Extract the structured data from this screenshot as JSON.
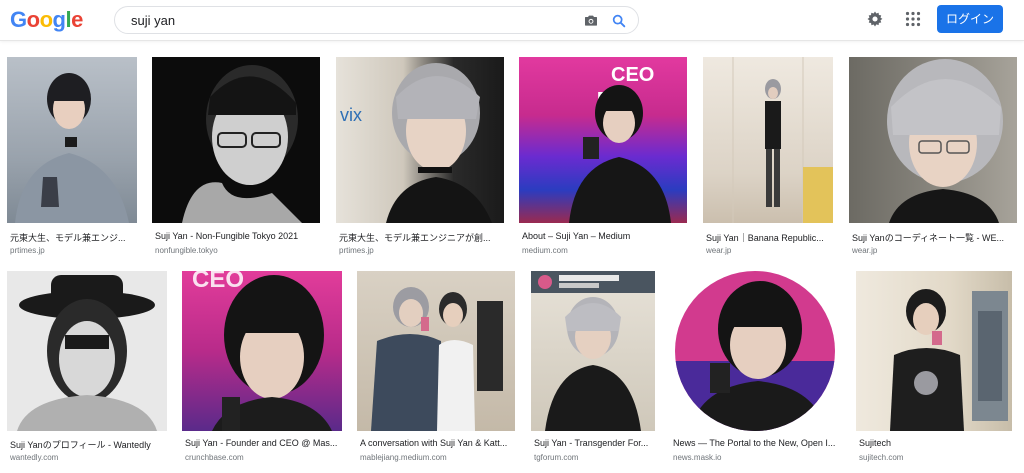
{
  "header": {
    "logo_text": "Google",
    "search_value": "suji yan",
    "login_label": "ログイン",
    "accent_color": "#1a73e8"
  },
  "icons": {
    "camera": "camera-icon",
    "search": "search-icon",
    "settings": "gear-icon",
    "apps": "apps-grid-icon"
  },
  "results": {
    "row1": [
      {
        "title": "元東大生、モデル兼エンジ...",
        "source": "prtimes.jp"
      },
      {
        "title": "Suji Yan - Non-Fungible Tokyo 2021",
        "source": "nonfungible.tokyo"
      },
      {
        "title": "元東大生、モデル兼エンジニアが創...",
        "source": "prtimes.jp"
      },
      {
        "title": "About – Suji Yan – Medium",
        "source": "medium.com"
      },
      {
        "title": "Suji Yan｜Banana Republic...",
        "source": "wear.jp"
      },
      {
        "title": "Suji Yanのコーディネート一覧 - WE...",
        "source": "wear.jp"
      }
    ],
    "row2": [
      {
        "title": "Suji Yanのプロフィール - Wantedly",
        "source": "wantedly.com"
      },
      {
        "title": "Suji Yan - Founder and CEO @ Mas...",
        "source": "crunchbase.com"
      },
      {
        "title": "A conversation with Suji Yan & Katt...",
        "source": "mablejiang.medium.com"
      },
      {
        "title": "Suji Yan - Transgender For...",
        "source": "tgforum.com"
      },
      {
        "title": "News — The Portal to the New, Open I...",
        "source": "news.mask.io"
      },
      {
        "title": "Sujitech",
        "source": "sujitech.com"
      }
    ]
  },
  "image_text": {
    "ceo": "CEO",
    "dav": "Dav",
    "vix": "vix"
  }
}
